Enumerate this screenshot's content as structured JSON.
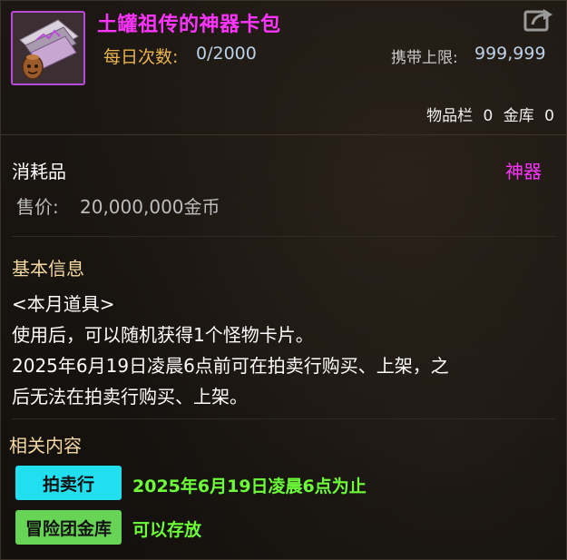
{
  "header": {
    "title": "土罐祖传的神器卡包",
    "daily_label": "每日次数:",
    "daily_value": "0/2000",
    "carry_label": "携带上限:",
    "carry_value": "999,999",
    "inventory_label": "物品栏",
    "inventory_count": "0",
    "vault_label": "金库",
    "vault_count": "0"
  },
  "item": {
    "type": "消耗品",
    "rarity": "神器",
    "price_label": "售价:",
    "price_value": "20,000,000金币"
  },
  "info": {
    "title": "基本信息",
    "lines": [
      "<本月道具>",
      "使用后，可以随机获得1个怪物卡片。",
      "2025年6月19日凌晨6点前可在拍卖行购买、上架，之",
      "后无法在拍卖行购买、上架。"
    ]
  },
  "related": {
    "title": "相关内容",
    "items": [
      {
        "tag": "拍卖行",
        "text": "2025年6月19日凌晨6点为止"
      },
      {
        "tag": "冒险团金库",
        "text": "可以存放"
      }
    ]
  },
  "colors": {
    "title": "#ff35ff",
    "rarity": "#ff35ff",
    "daily_label": "#e9b44c",
    "section_title": "#f5d9a0",
    "auction_tag": "#22dff0",
    "guild_tag": "#67d455",
    "related_text": "#6dff38"
  },
  "icons": {
    "item": "card-pack-icon",
    "share": "share-export-icon"
  }
}
